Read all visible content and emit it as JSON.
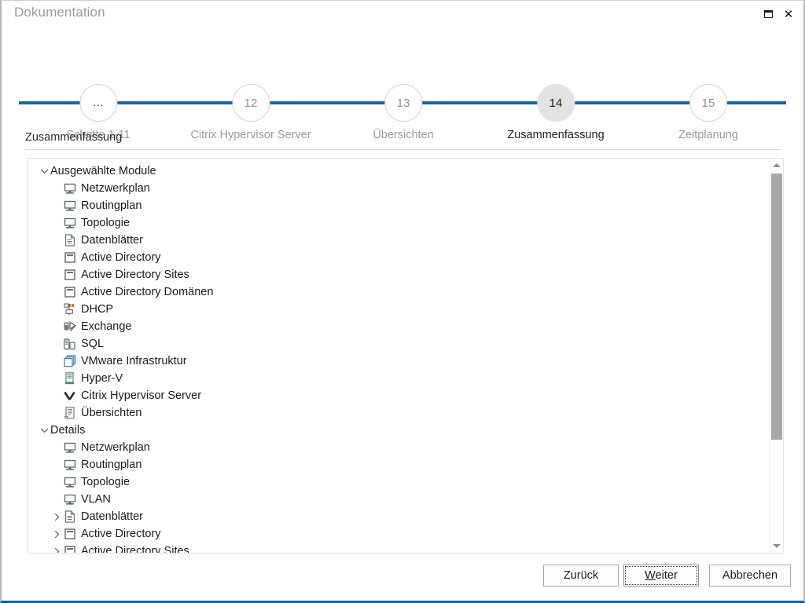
{
  "window": {
    "title": "Dokumentation",
    "controls": [
      {
        "name": "maximize-button",
        "glyph": "maximize-icon"
      },
      {
        "name": "close-button",
        "glyph": "close-icon"
      }
    ],
    "accent_color": "#1468ae",
    "active_step_fill": "#e3e3e3"
  },
  "stepper": {
    "steps": [
      {
        "number": "...",
        "label": "Schritte 1-11",
        "active": false
      },
      {
        "number": "12",
        "label": "Citrix Hypervisor Server",
        "active": false
      },
      {
        "number": "13",
        "label": "Übersichten",
        "active": false
      },
      {
        "number": "14",
        "label": "Zusammenfassung",
        "active": true
      },
      {
        "number": "15",
        "label": "Zeitplanung",
        "active": false
      }
    ]
  },
  "section": {
    "caption": "Zusammenfassung"
  },
  "tree": {
    "nodes": [
      {
        "level": 0,
        "twisty": "expanded",
        "icon": "none",
        "label": "Ausgewählte Module"
      },
      {
        "level": 1,
        "twisty": "none",
        "icon": "monitor-icon",
        "label": "Netzwerkplan"
      },
      {
        "level": 1,
        "twisty": "none",
        "icon": "monitor-icon",
        "label": "Routingplan"
      },
      {
        "level": 1,
        "twisty": "none",
        "icon": "monitor-icon",
        "label": "Topologie"
      },
      {
        "level": 1,
        "twisty": "none",
        "icon": "document-icon",
        "label": "Datenblätter"
      },
      {
        "level": 1,
        "twisty": "none",
        "icon": "window-icon",
        "label": "Active Directory"
      },
      {
        "level": 1,
        "twisty": "none",
        "icon": "window-icon",
        "label": "Active Directory Sites"
      },
      {
        "level": 1,
        "twisty": "none",
        "icon": "window-icon",
        "label": "Active Directory Domänen"
      },
      {
        "level": 1,
        "twisty": "none",
        "icon": "dhcp-icon",
        "label": "DHCP"
      },
      {
        "level": 1,
        "twisty": "none",
        "icon": "exchange-icon",
        "label": "Exchange"
      },
      {
        "level": 1,
        "twisty": "none",
        "icon": "sql-icon",
        "label": "SQL"
      },
      {
        "level": 1,
        "twisty": "none",
        "icon": "vmware-icon",
        "label": "VMware Infrastruktur"
      },
      {
        "level": 1,
        "twisty": "none",
        "icon": "hyperv-icon",
        "label": "Hyper-V"
      },
      {
        "level": 1,
        "twisty": "none",
        "icon": "citrix-icon",
        "label": "Citrix Hypervisor Server"
      },
      {
        "level": 1,
        "twisty": "none",
        "icon": "overview-icon",
        "label": "Übersichten"
      },
      {
        "level": 0,
        "twisty": "expanded",
        "icon": "none",
        "label": "Details"
      },
      {
        "level": 1,
        "twisty": "none",
        "icon": "monitor-icon",
        "label": "Netzwerkplan"
      },
      {
        "level": 1,
        "twisty": "none",
        "icon": "monitor-icon",
        "label": "Routingplan"
      },
      {
        "level": 1,
        "twisty": "none",
        "icon": "monitor-icon",
        "label": "Topologie"
      },
      {
        "level": 1,
        "twisty": "none",
        "icon": "monitor-icon",
        "label": "VLAN"
      },
      {
        "level": 1,
        "twisty": "collapsed",
        "icon": "document-icon",
        "label": "Datenblätter"
      },
      {
        "level": 1,
        "twisty": "collapsed",
        "icon": "window-icon",
        "label": "Active Directory"
      },
      {
        "level": 1,
        "twisty": "collapsed",
        "icon": "window-icon",
        "label": "Active Directory Sites"
      }
    ]
  },
  "scrollbar": {
    "up_arrow": "scroll-up-icon",
    "down_arrow": "scroll-down-icon"
  },
  "footer": {
    "back_label": "Zurück",
    "next_label_mnemonic": "W",
    "next_label_rest": "eiter",
    "cancel_label": "Abbrechen"
  }
}
